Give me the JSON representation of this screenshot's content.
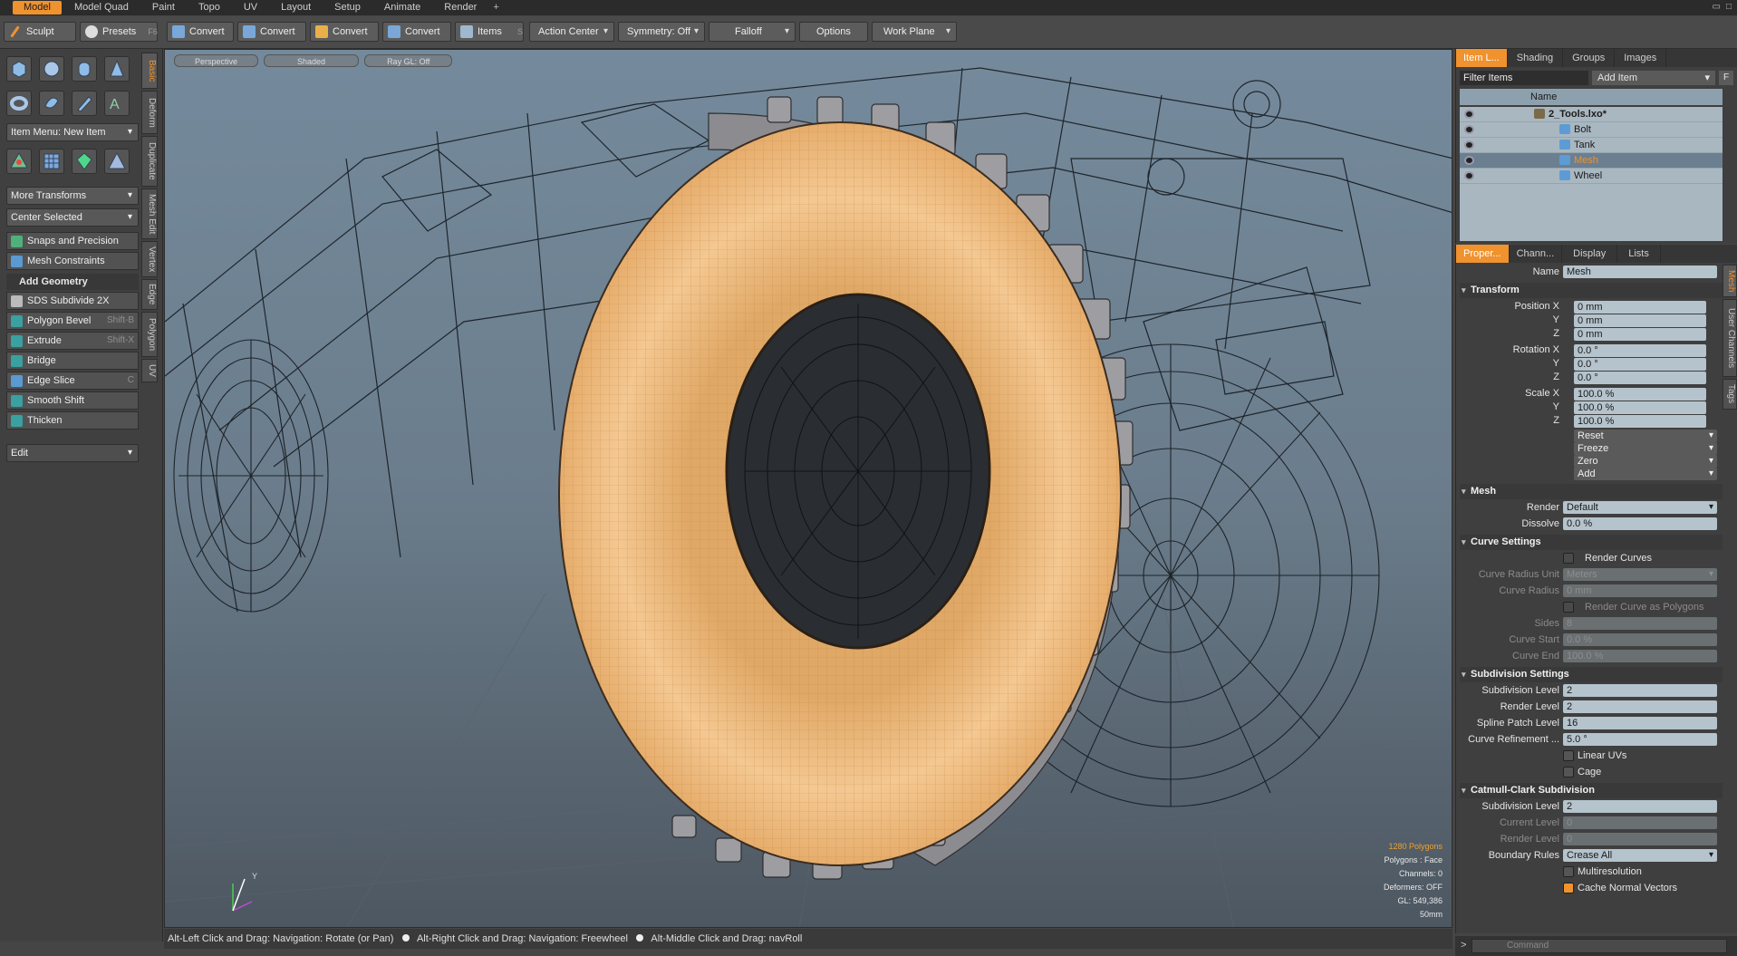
{
  "layout_tabs": [
    "Model",
    "Model Quad",
    "Paint",
    "Topo",
    "UV",
    "Layout",
    "Setup",
    "Animate",
    "Render"
  ],
  "layout_tab_add": "+",
  "toolbar": {
    "sculpt": "Sculpt",
    "presets": "Presets",
    "presets_shortcut": "F6",
    "convert": [
      "Convert",
      "Convert",
      "Convert",
      "Convert"
    ],
    "items": "Items",
    "items_shortcut": "S",
    "action_center": "Action Center",
    "symmetry": "Symmetry: Off",
    "falloff": "Falloff",
    "options": "Options",
    "work_plane": "Work Plane"
  },
  "left_panel": {
    "vertical_tabs": [
      "Basic",
      "Deform",
      "Duplicate",
      "Mesh Edit",
      "Vertex",
      "Edge",
      "Polygon",
      "UV"
    ],
    "item_menu": "Item Menu: New Item",
    "more_transforms": "More Transforms",
    "center_selected": "Center Selected",
    "snaps": "Snaps and Precision",
    "mesh_constraints": "Mesh Constraints",
    "add_geometry": "Add Geometry",
    "tools": [
      {
        "label": "SDS Subdivide 2X",
        "shortcut": ""
      },
      {
        "label": "Polygon Bevel",
        "shortcut": "Shift-B"
      },
      {
        "label": "Extrude",
        "shortcut": "Shift-X"
      },
      {
        "label": "Bridge",
        "shortcut": ""
      },
      {
        "label": "Edge Slice",
        "shortcut": "C"
      },
      {
        "label": "Smooth Shift",
        "shortcut": ""
      },
      {
        "label": "Thicken",
        "shortcut": ""
      }
    ],
    "edit": "Edit"
  },
  "viewport": {
    "tabs": [
      "Perspective",
      "Shaded",
      "Ray GL: Off"
    ],
    "hud": {
      "polygons": "1280 Polygons",
      "mode": "Polygons : Face",
      "channels": "Channels: 0",
      "deformers": "Deformers: OFF",
      "gl": "GL: 549,386",
      "scale": "50mm"
    }
  },
  "status": {
    "a": "Alt-Left Click and Drag: Navigation: Rotate (or Pan)",
    "b": "Alt-Right Click and Drag: Navigation: Freewheel",
    "c": "Alt-Middle Click and Drag: navRoll"
  },
  "item_list": {
    "tabs": [
      "Item L...",
      "Shading",
      "Groups",
      "Images"
    ],
    "filter": "Filter Items",
    "add_item": "Add Item",
    "add_item_f": "F",
    "col_name": "Name",
    "items": [
      "2_Tools.lxo*",
      "Bolt",
      "Tank",
      "Mesh",
      "Wheel"
    ],
    "selected": "Mesh"
  },
  "properties": {
    "tabs": [
      "Proper...",
      "Chann...",
      "Display",
      "Lists"
    ],
    "side_tabs": [
      "Mesh",
      "User Channels",
      "Tags"
    ],
    "name_label": "Name",
    "name_value": "Mesh",
    "transform_hdr": "Transform",
    "position_label": "Position X",
    "rotation_label": "Rotation X",
    "scale_label": "Scale X",
    "axis_y": "Y",
    "axis_z": "Z",
    "position": [
      "0 mm",
      "0 mm",
      "0 mm"
    ],
    "rotation": [
      "0.0 °",
      "0.0 °",
      "0.0 °"
    ],
    "scale": [
      "100.0 %",
      "100.0 %",
      "100.0 %"
    ],
    "transform_actions": [
      "Reset",
      "Freeze",
      "Zero",
      "Add"
    ],
    "mesh_hdr": "Mesh",
    "render_label": "Render",
    "render_value": "Default",
    "dissolve_label": "Dissolve",
    "dissolve_value": "0.0 %",
    "curve_hdr": "Curve Settings",
    "render_curves": "Render Curves",
    "curve_radius_unit_label": "Curve Radius Unit",
    "curve_radius_unit_value": "Meters",
    "curve_radius_label": "Curve Radius",
    "curve_radius_value": "0 mm",
    "render_curve_polys": "Render Curve as Polygons",
    "sides_label": "Sides",
    "sides_value": "8",
    "curve_start_label": "Curve Start",
    "curve_start_value": "0.0 %",
    "curve_end_label": "Curve End",
    "curve_end_value": "100.0 %",
    "subdiv_hdr": "Subdivision Settings",
    "subdiv_level_label": "Subdivision Level",
    "subdiv_level_value": "2",
    "render_level_label": "Render Level",
    "render_level_value": "2",
    "spline_label": "Spline Patch Level",
    "spline_value": "16",
    "curve_ref_label": "Curve Refinement ...",
    "curve_ref_value": "5.0 °",
    "linear_uvs": "Linear UVs",
    "cage": "Cage",
    "cc_hdr": "Catmull-Clark Subdivision",
    "cc_subdiv_label": "Subdivision Level",
    "cc_subdiv_value": "2",
    "cc_current_label": "Current Level",
    "cc_current_value": "0",
    "cc_render_label": "Render Level",
    "cc_render_value": "0",
    "boundary_label": "Boundary Rules",
    "boundary_value": "Crease All",
    "multires": "Multiresolution",
    "cache_normals": "Cache Normal Vectors"
  },
  "command": {
    "prompt": ">",
    "placeholder": "Command"
  },
  "colors": {
    "accent": "#f0922e",
    "tire": "#f3c48c",
    "wire": "#1a1a1a"
  }
}
